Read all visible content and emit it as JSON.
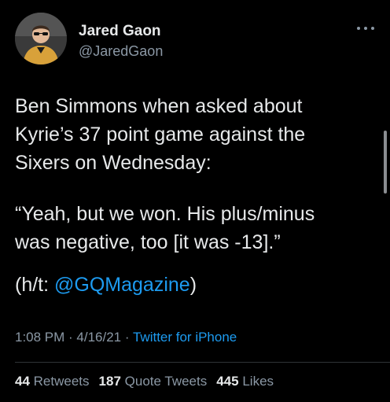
{
  "author": {
    "display_name": "Jared Gaon",
    "handle": "@JaredGaon"
  },
  "tweet": {
    "line1": "Ben Simmons when asked about",
    "line2": "Kyrie’s 37 point game against the",
    "line3": "Sixers on Wednesday:",
    "quote_line1": "“Yeah, but we won. His plus/minus",
    "quote_line2": "was negative, too [it was -13].”",
    "credit_prefix": "(h/t: ",
    "credit_mention": "@GQMagazine",
    "credit_suffix": ")"
  },
  "meta": {
    "time": "1:08 PM",
    "separator": " · ",
    "date": "4/16/21",
    "source": "Twitter for iPhone"
  },
  "stats": {
    "retweets_count": "44",
    "retweets_label": "Retweets",
    "quote_tweets_count": "187",
    "quote_tweets_label": "Quote Tweets",
    "likes_count": "445",
    "likes_label": "Likes"
  },
  "icons": {
    "more": "more-horizontal-icon",
    "avatar": "avatar-image"
  },
  "colors": {
    "background": "#000000",
    "text": "#e7e9ea",
    "secondary": "#8b98a5",
    "link": "#1d9bf0"
  }
}
